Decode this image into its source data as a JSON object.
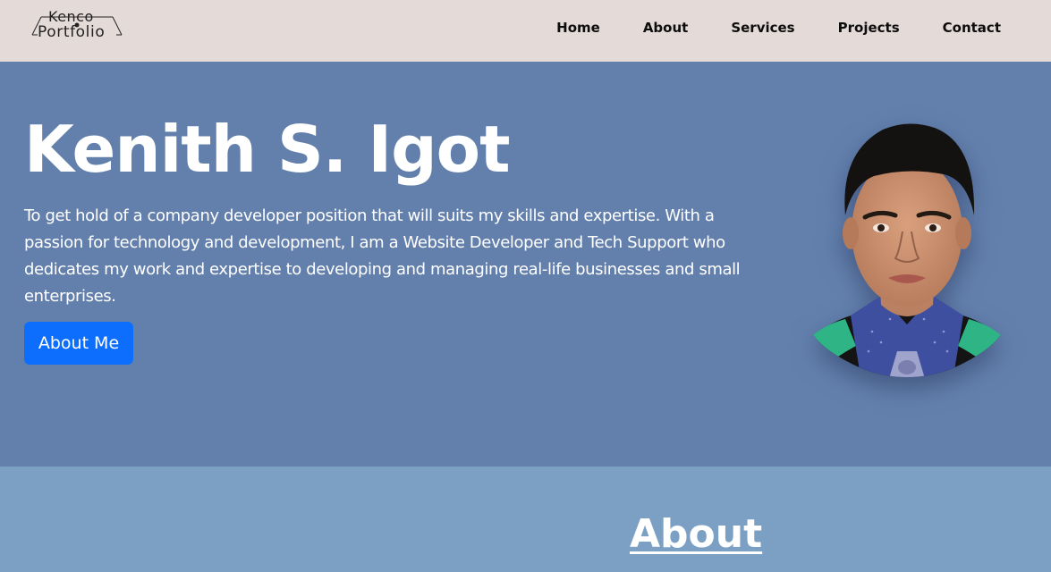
{
  "logo": {
    "line1": "Kenco",
    "line2": "Portfolio"
  },
  "nav": {
    "items": [
      {
        "label": "Home"
      },
      {
        "label": "About"
      },
      {
        "label": "Services"
      },
      {
        "label": "Projects"
      },
      {
        "label": "Contact"
      }
    ]
  },
  "hero": {
    "name": "Kenith S. Igot",
    "description": "To get hold of a company developer position that will suits my skills and expertise. With a passion for technology and development, I am a Website Developer and Tech Support who dedicates my work and expertise to developing and managing real-life businesses and small enterprises.",
    "button_label": "About Me"
  },
  "about": {
    "title": "About"
  },
  "colors": {
    "navbar_bg": "#e4dbd8",
    "hero_bg": "#6380ad",
    "about_bg": "#7ca0c4",
    "button_bg": "#0d6efd"
  }
}
